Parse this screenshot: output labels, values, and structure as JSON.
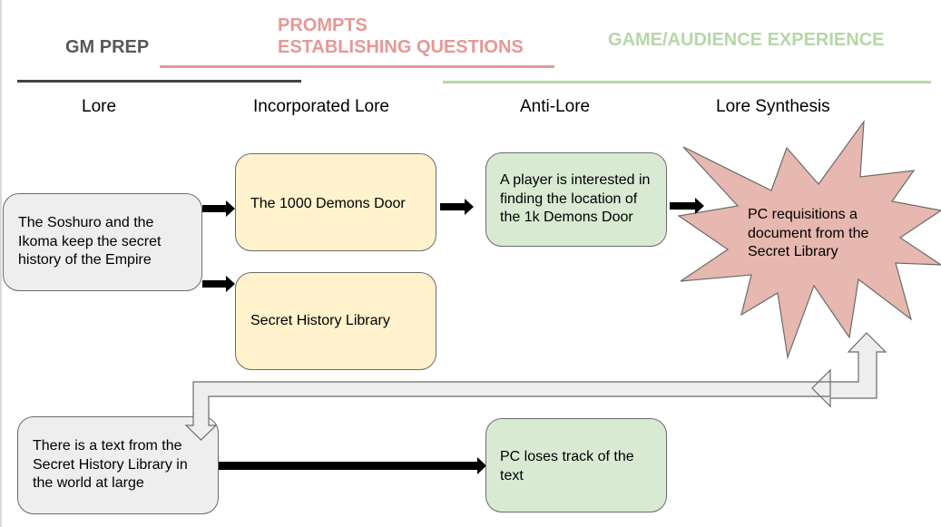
{
  "headers": {
    "gm_prep": "GM PREP",
    "prompts_line1": "PROMPTS",
    "prompts_line2": "ESTABLISHING QUESTIONS",
    "game_experience": "GAME/AUDIENCE EXPERIENCE"
  },
  "columns": {
    "lore": "Lore",
    "incorporated_lore": "Incorporated Lore",
    "anti_lore": "Anti-Lore",
    "lore_synthesis": "Lore Synthesis"
  },
  "nodes": {
    "lore_source": "The Soshuro and the Ikoma keep the secret history of the Empire",
    "demons_door": "The 1000 Demons Door",
    "secret_library": "Secret History Library",
    "player_interest": "A player is interested in finding the location of the 1k Demons Door",
    "synthesis": "PC requisitions a document from the Secret Library",
    "text_in_world": "There is a text from the Secret History Library in the world at large",
    "pc_loses_text": "PC loses track of the text"
  },
  "colors": {
    "gm_prep": "#434343",
    "prompts": "#e69896",
    "game_experience": "#b6d7a8",
    "lore_box": "#eeeeee",
    "incorporated_box": "#fff2cc",
    "anti_lore_box": "#d9ead3",
    "synthesis_burst": "#e6b8af"
  }
}
